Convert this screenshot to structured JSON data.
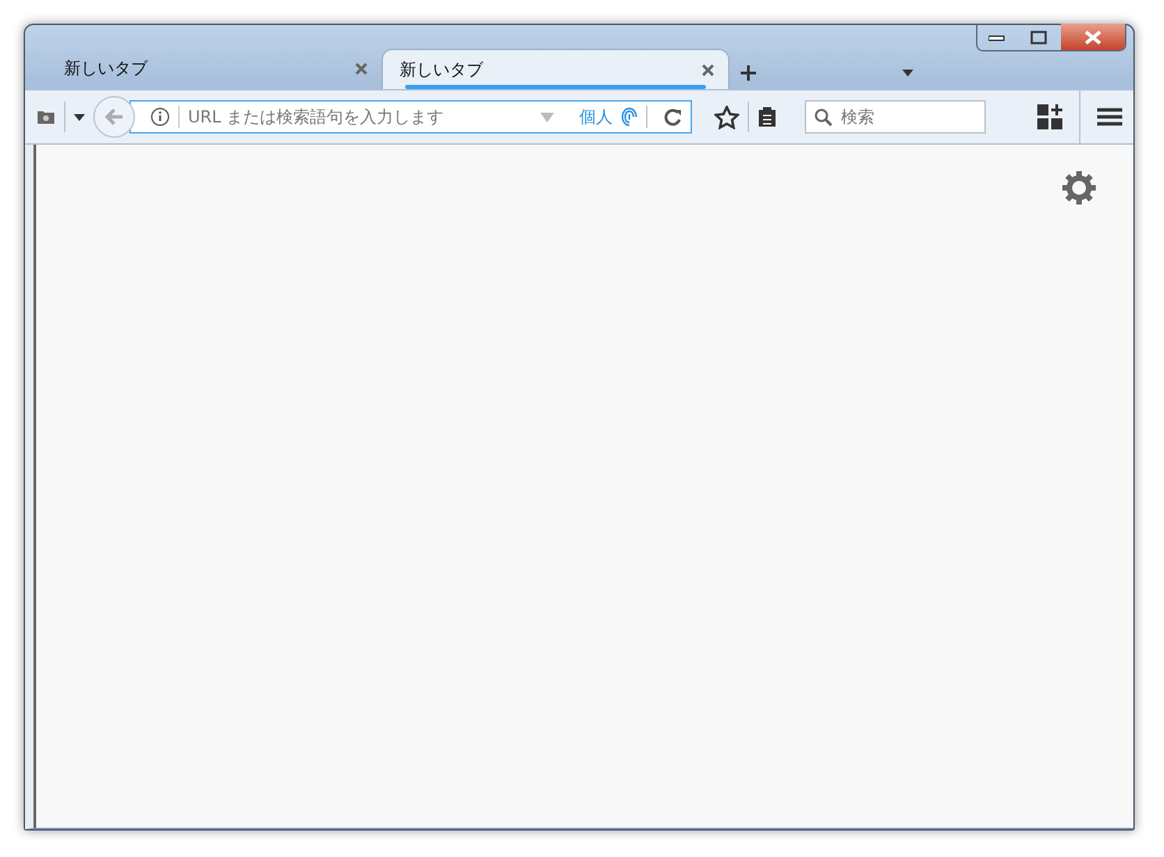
{
  "tabs": [
    {
      "label": "新しいタブ",
      "selected": false
    },
    {
      "label": "新しいタブ",
      "selected": true
    }
  ],
  "url_bar": {
    "placeholder": "URL または検索語句を入力します",
    "private_label": "個人"
  },
  "search": {
    "placeholder": "検索"
  }
}
